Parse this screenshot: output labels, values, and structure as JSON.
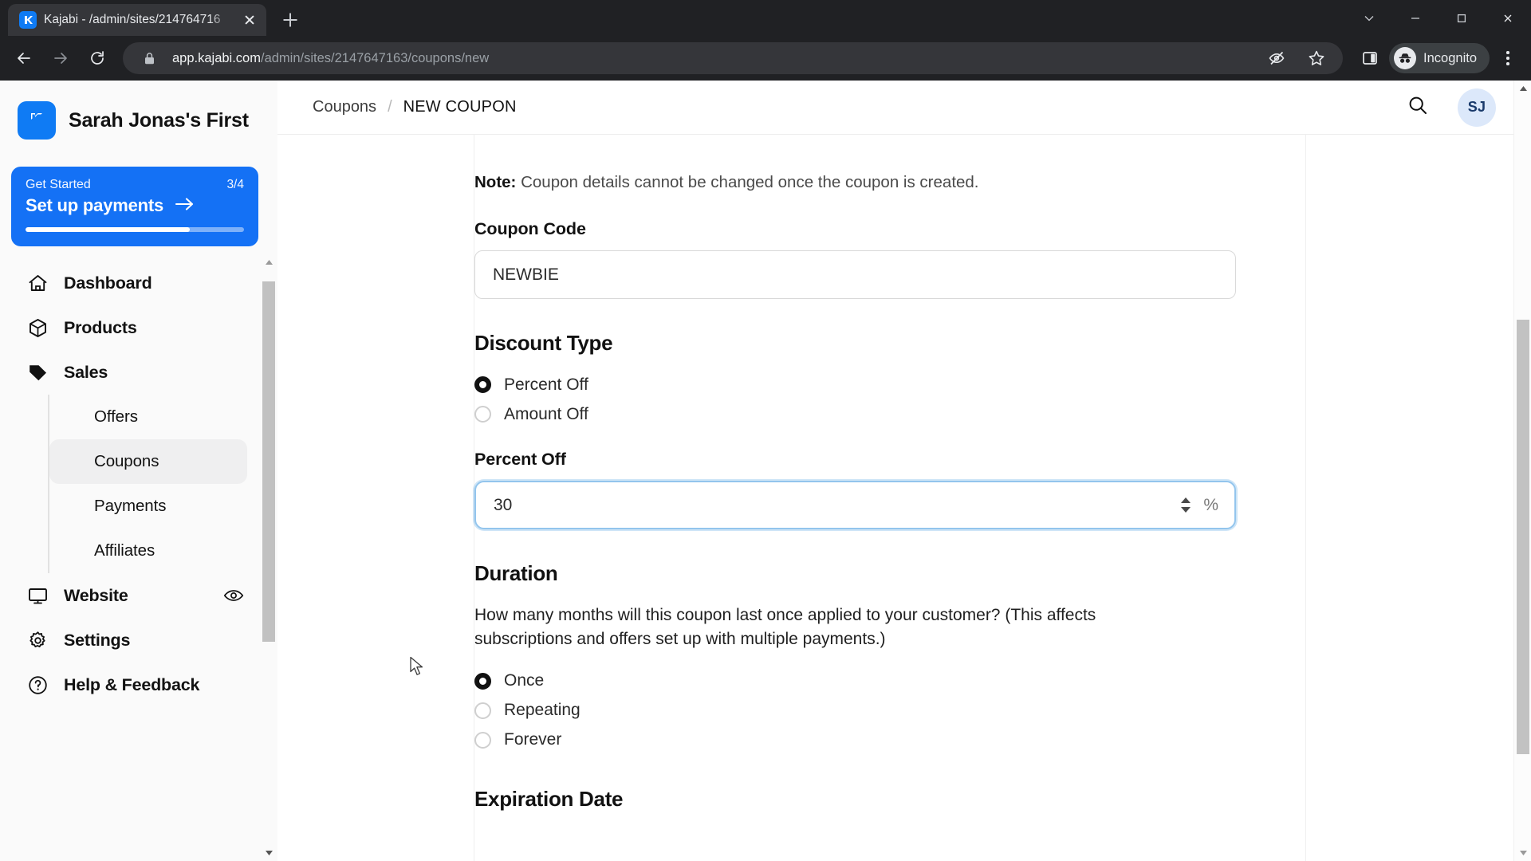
{
  "browser": {
    "tab": {
      "title": "Kajabi - /admin/sites/214764716",
      "favicon_icon": "kajabi-favicon",
      "close_icon": "close-icon"
    },
    "new_tab_icon": "plus-icon",
    "window_controls": [
      {
        "name": "tab-search-button",
        "icon": "chevron-down-icon"
      },
      {
        "name": "minimize-button",
        "icon": "minimize-icon"
      },
      {
        "name": "maximize-button",
        "icon": "maximize-icon"
      },
      {
        "name": "close-window-button",
        "icon": "close-icon"
      }
    ],
    "nav": {
      "back_icon": "arrow-left-icon",
      "forward_icon": "arrow-right-icon",
      "reload_icon": "reload-icon"
    },
    "omnibox": {
      "lock_icon": "lock-icon",
      "url_domain": "app.kajabi.com",
      "url_path": "/admin/sites/2147647163/coupons/new",
      "full_url": "app.kajabi.com/admin/sites/2147647163/coupons/new",
      "tracking_protection_icon": "eye-slash-icon",
      "bookmark_icon": "star-icon"
    },
    "side_panel_icon": "side-panel-icon",
    "incognito": {
      "label": "Incognito",
      "icon": "incognito-icon"
    },
    "menu_icon": "kebab-menu-icon"
  },
  "sidebar": {
    "brand": {
      "name": "Sarah Jonas's First",
      "logo_icon": "kajabi-logo-icon"
    },
    "get_started": {
      "title": "Get Started",
      "count": "3/4",
      "action": "Set up payments",
      "arrow_icon": "arrow-right-icon",
      "progress_percent": 75,
      "color": "#1471f5"
    },
    "items": [
      {
        "label": "Dashboard",
        "icon": "home-icon",
        "active": false
      },
      {
        "label": "Products",
        "icon": "box-icon",
        "active": false
      },
      {
        "label": "Sales",
        "icon": "tag-icon",
        "active": false,
        "expanded": true
      },
      {
        "label": "Website",
        "icon": "monitor-icon",
        "active": false,
        "trailing_icon": "eye-icon"
      },
      {
        "label": "Settings",
        "icon": "gear-icon",
        "active": false
      },
      {
        "label": "Help & Feedback",
        "icon": "question-circle-icon",
        "active": false
      }
    ],
    "sales_subitems": [
      {
        "label": "Offers",
        "active": false
      },
      {
        "label": "Coupons",
        "active": true
      },
      {
        "label": "Payments",
        "active": false
      },
      {
        "label": "Affiliates",
        "active": false
      }
    ],
    "scrollbar": {
      "up_arrow_icon": "caret-up-icon",
      "down_arrow_icon": "caret-down-icon"
    }
  },
  "topbar": {
    "breadcrumb": {
      "parent": "Coupons",
      "separator": "/",
      "current": "NEW COUPON"
    },
    "search_icon": "search-icon",
    "avatar_initials": "SJ"
  },
  "form": {
    "note_prefix": "Note:",
    "note_text": " Coupon details cannot be changed once the coupon is created.",
    "coupon_code": {
      "label": "Coupon Code",
      "value": "NEWBIE",
      "placeholder": ""
    },
    "discount_type": {
      "title": "Discount Type",
      "options": [
        {
          "label": "Percent Off",
          "checked": true
        },
        {
          "label": "Amount Off",
          "checked": false
        }
      ]
    },
    "percent_off": {
      "label": "Percent Off",
      "value": "30",
      "unit": "%",
      "focused": true,
      "focus_color": "#93c5ed",
      "spinner_up_icon": "caret-up-icon",
      "spinner_down_icon": "caret-down-icon"
    },
    "duration": {
      "title": "Duration",
      "help": "How many months will this coupon last once applied to your customer? (This affects subscriptions and offers set up with multiple payments.)",
      "options": [
        {
          "label": "Once",
          "checked": true
        },
        {
          "label": "Repeating",
          "checked": false
        },
        {
          "label": "Forever",
          "checked": false
        }
      ]
    },
    "expiration": {
      "title": "Expiration Date"
    }
  },
  "page_scrollbar": {
    "up_arrow_icon": "caret-up-icon",
    "down_arrow_icon": "caret-down-icon"
  }
}
